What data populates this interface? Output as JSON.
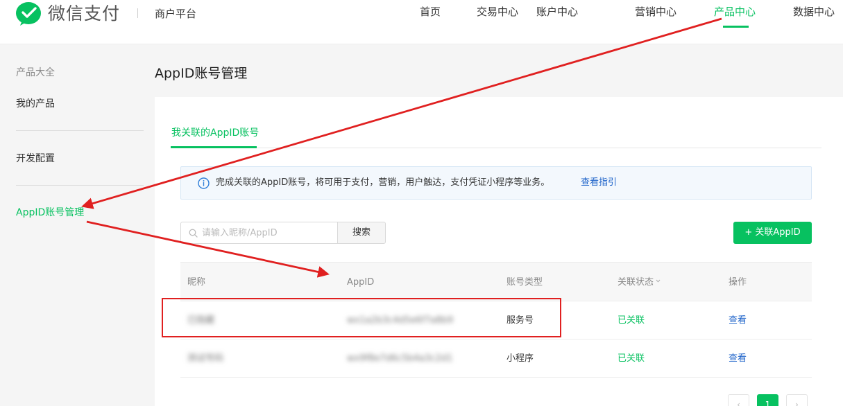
{
  "header": {
    "brand": "微信支付",
    "platform": "商户平台",
    "nav": [
      {
        "label": "首页"
      },
      {
        "label": "交易中心"
      },
      {
        "label": "账户中心"
      },
      {
        "label": "营销中心"
      },
      {
        "label": "产品中心"
      },
      {
        "label": "数据中心"
      }
    ],
    "active_nav": "产品中心",
    "logo_icon": "wechat-pay-logo-icon"
  },
  "sidebar": {
    "category": "产品大全",
    "items": [
      {
        "label": "我的产品"
      },
      {
        "label": "开发配置"
      },
      {
        "label": "AppID账号管理"
      }
    ],
    "active_item": "AppID账号管理"
  },
  "main": {
    "title": "AppID账号管理",
    "tab": "我关联的AppID账号",
    "notice": {
      "icon": "info-circle-icon",
      "text": "完成关联的AppID账号，将可用于支付，营销，用户触达，支付凭证小程序等业务。",
      "link": "查看指引"
    },
    "search": {
      "placeholder": "请输入昵称/AppID",
      "value": "",
      "button": "搜索",
      "icon": "search-icon"
    },
    "add_button": "+ 关联AppID",
    "table": {
      "columns": [
        "昵称",
        "AppID",
        "账号类型",
        "关联状态",
        "操作"
      ],
      "status_filter_icon": "chevron-down-icon",
      "rows": [
        {
          "nickname": "已隐藏",
          "appid": "wx1a2b3c4d5e6f7a8b9",
          "type": "服务号",
          "status": "已关联",
          "action": "查看"
        },
        {
          "nickname": "测试号码",
          "appid": "wx9f8e7d6c5b4a3c2d1",
          "type": "小程序",
          "status": "已关联",
          "action": "查看"
        }
      ]
    },
    "pagination": {
      "prev": "‹",
      "current": "1",
      "next": "›"
    }
  },
  "colors": {
    "accent": "#07c160",
    "link": "#1e63c9",
    "annotation": "#e02020"
  }
}
